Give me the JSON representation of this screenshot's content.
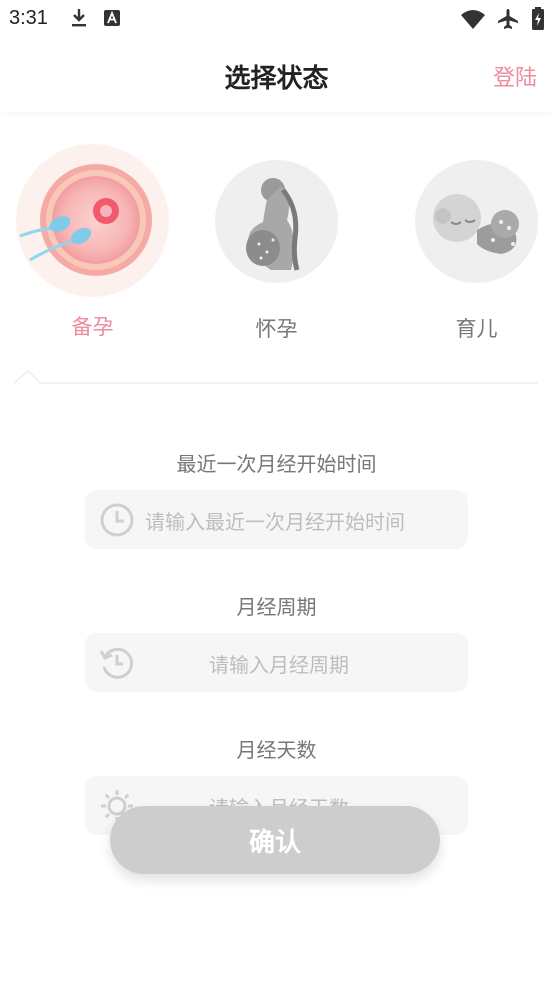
{
  "status_bar": {
    "time": "3:31"
  },
  "header": {
    "title": "选择状态",
    "login_label": "登陆"
  },
  "status_options": [
    {
      "label": "备孕",
      "icon": "egg-sperm-icon",
      "selected": true
    },
    {
      "label": "怀孕",
      "icon": "pregnant-woman-icon",
      "selected": false
    },
    {
      "label": "育儿",
      "icon": "sleeping-baby-icon",
      "selected": false
    }
  ],
  "form": {
    "last_period": {
      "label": "最近一次月经开始时间",
      "placeholder": "请输入最近一次月经开始时间",
      "icon": "clock-icon"
    },
    "cycle": {
      "label": "月经周期",
      "placeholder": "请输入月经周期",
      "icon": "cycle-clock-icon"
    },
    "days": {
      "label": "月经天数",
      "placeholder": "请输入月经天数",
      "icon": "sun-icon"
    }
  },
  "confirm_label": "确认",
  "colors": {
    "accent": "#f08aa0",
    "button_disabled": "#cdcdcd",
    "field_bg": "#f6f6f6"
  }
}
